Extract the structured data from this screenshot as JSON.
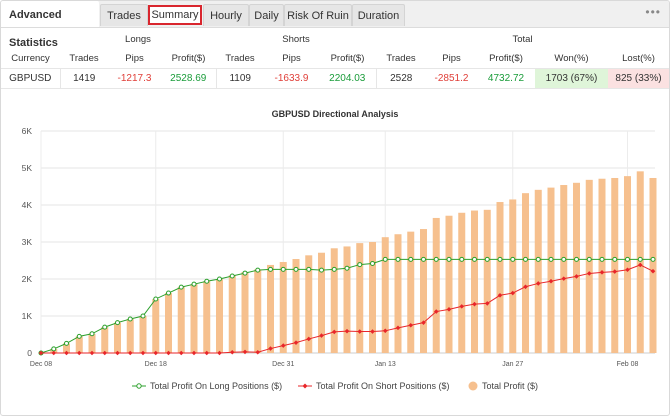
{
  "tabs": {
    "title": "Advanced Statistics",
    "items": [
      "Trades",
      "Summary",
      "Hourly",
      "Daily",
      "Risk Of Ruin",
      "Duration"
    ],
    "active": "Summary",
    "more": "•••"
  },
  "table": {
    "groups": [
      "Longs",
      "Shorts",
      "Total"
    ],
    "headers": [
      "Currency",
      "Trades",
      "Pips",
      "Profit($)",
      "Trades",
      "Pips",
      "Profit($)",
      "Trades",
      "Pips",
      "Profit($)",
      "Won(%)",
      "Lost(%)"
    ],
    "row": [
      "GBPUSD",
      "1419",
      "-1217.3",
      "2528.69",
      "1109",
      "-1633.9",
      "2204.03",
      "2528",
      "-2851.2",
      "4732.72",
      "1703 (67%)",
      "825 (33%)"
    ]
  },
  "chart_data": {
    "type": "bar+line",
    "title": "GBPUSD Directional Analysis",
    "yticks": [
      "0",
      "1K",
      "2K",
      "3K",
      "4K",
      "5K",
      "6K"
    ],
    "ylim": [
      0,
      6000
    ],
    "xticks": [
      "Dec 08",
      "Dec 18",
      "Dec 31",
      "Jan 13",
      "Jan 27",
      "Feb 08"
    ],
    "grid": true,
    "legend_position": "bottom",
    "colors": {
      "long": "#2ca02c",
      "short": "#e8262a",
      "total": "#f6c08e"
    },
    "series": [
      {
        "name": "Total Profit On Long Positions ($)",
        "kind": "line",
        "values": [
          0,
          110,
          260,
          450,
          520,
          700,
          820,
          920,
          1000,
          1460,
          1620,
          1780,
          1860,
          1940,
          2000,
          2080,
          2160,
          2240,
          2260,
          2260,
          2260,
          2260,
          2240,
          2260,
          2290,
          2390,
          2420,
          2530,
          2530,
          2530,
          2530,
          2530,
          2530,
          2530,
          2530,
          2530,
          2530,
          2530,
          2530,
          2530,
          2530,
          2530,
          2530,
          2530,
          2530,
          2530,
          2530,
          2530,
          2530
        ]
      },
      {
        "name": "Total Profit On Short Positions ($)",
        "kind": "line",
        "values": [
          0,
          0,
          0,
          0,
          0,
          0,
          0,
          0,
          0,
          0,
          0,
          0,
          0,
          0,
          0,
          20,
          30,
          20,
          120,
          200,
          280,
          380,
          470,
          570,
          590,
          580,
          580,
          600,
          680,
          750,
          820,
          1120,
          1180,
          1260,
          1320,
          1340,
          1560,
          1620,
          1790,
          1880,
          1940,
          2010,
          2070,
          2150,
          2180,
          2200,
          2250,
          2380,
          2210
        ]
      },
      {
        "name": "Total Profit ($)",
        "kind": "bar",
        "values": [
          0,
          110,
          260,
          450,
          520,
          700,
          820,
          920,
          1000,
          1460,
          1620,
          1780,
          1860,
          1940,
          2000,
          2100,
          2190,
          2260,
          2380,
          2460,
          2540,
          2640,
          2710,
          2830,
          2880,
          2970,
          3000,
          3130,
          3210,
          3280,
          3350,
          3650,
          3710,
          3790,
          3850,
          3870,
          4080,
          4150,
          4320,
          4410,
          4470,
          4540,
          4600,
          4680,
          4710,
          4730,
          4780,
          4910,
          4730
        ]
      }
    ]
  }
}
